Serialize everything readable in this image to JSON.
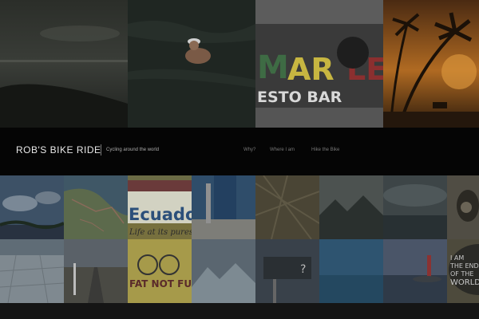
{
  "header": {
    "site_title": "ROB'S BIKE RIDE",
    "tagline": "Cycling around the world",
    "nav": [
      {
        "label": "Why?"
      },
      {
        "label": "Where I am"
      },
      {
        "label": "Hike the Bike"
      }
    ]
  },
  "top_photos": [
    {
      "name": "photo-dark-sea"
    },
    {
      "name": "photo-swimmer"
    },
    {
      "name": "photo-marley-bar",
      "sign_text": "MARLEY",
      "sign_sub": "ESTO BAR"
    },
    {
      "name": "photo-palm-sunset"
    }
  ],
  "grid_photos": {
    "ecuador_sign": {
      "line1": "Ecuador",
      "line2": "Life at its purest"
    },
    "fat_sign": "FAT NOT FU",
    "end_sign": {
      "line1": "I AM",
      "line2": "THE END",
      "line3": "OF THE",
      "line4": "WORLD"
    },
    "question_sign": "?"
  },
  "colors": {
    "nav_bg": "#050505",
    "title_text": "#e8e8e8",
    "tagline_text": "#aaaaaa",
    "nav_text": "#777777",
    "page_bg": "#141414"
  }
}
